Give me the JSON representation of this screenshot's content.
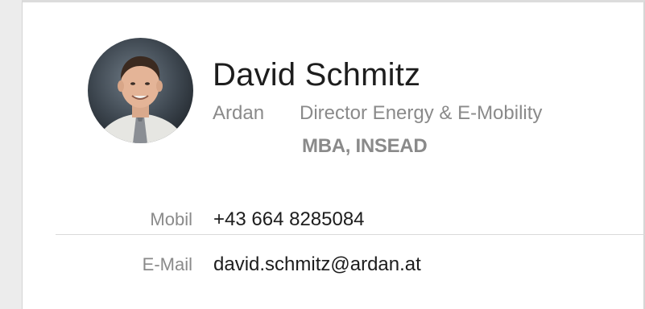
{
  "contact": {
    "name": "David Schmitz",
    "company": "Ardan",
    "job_title": "Director Energy & E-Mobility",
    "department": "MBA, INSEAD"
  },
  "fields": [
    {
      "label": "Mobil",
      "value": "+43 664 8285084"
    },
    {
      "label": "E-Mail",
      "value": "david.schmitz@ardan.at"
    }
  ],
  "colors": {
    "text_primary": "#1d1d1d",
    "text_secondary": "#8a8a8a",
    "background": "#ffffff",
    "divider": "#d9d9d9"
  }
}
